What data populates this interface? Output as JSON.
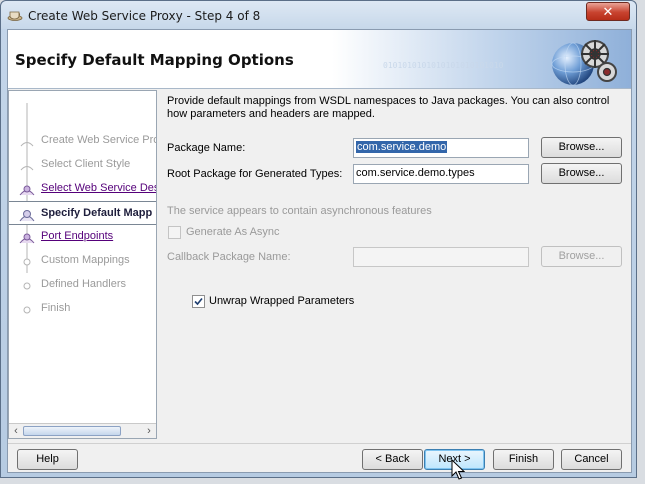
{
  "window": {
    "title": "Create Web Service Proxy - Step 4 of 8",
    "close_symbol": "✕"
  },
  "header": {
    "title": "Specify Default Mapping Options",
    "binary_text": "0101010101010101010101010"
  },
  "steps": [
    {
      "label": "Create Web Service Pro",
      "state": "disabled"
    },
    {
      "label": "Select Client Style",
      "state": "disabled"
    },
    {
      "label": "Select Web Service Desc",
      "state": "link"
    },
    {
      "label": "Specify Default Mapp",
      "state": "current"
    },
    {
      "label": "Port Endpoints",
      "state": "link"
    },
    {
      "label": "Custom Mappings",
      "state": "disabled"
    },
    {
      "label": "Defined Handlers",
      "state": "disabled"
    },
    {
      "label": "Finish",
      "state": "disabled"
    }
  ],
  "form": {
    "intro": "Provide default mappings from WSDL namespaces to Java packages. You can also control how parameters and headers are mapped.",
    "package_name_label": "Package Name:",
    "package_name_value": "com.service.demo",
    "root_package_label": "Root Package for Generated Types:",
    "root_package_value": "com.service.demo.types",
    "browse_label": "Browse...",
    "async_note": "The service appears to contain asynchronous features",
    "generate_async_label": "Generate As Async",
    "callback_label": "Callback Package Name:",
    "callback_value": "",
    "unwrap_label": "Unwrap Wrapped Parameters",
    "unwrap_checked": true
  },
  "buttons": {
    "help": "Help",
    "back": "< Back",
    "next": "Next >",
    "finish": "Finish",
    "cancel": "Cancel"
  },
  "colors": {
    "selection": "#3366aa",
    "link": "#55007a",
    "disabled_text": "#9a9a9a"
  }
}
